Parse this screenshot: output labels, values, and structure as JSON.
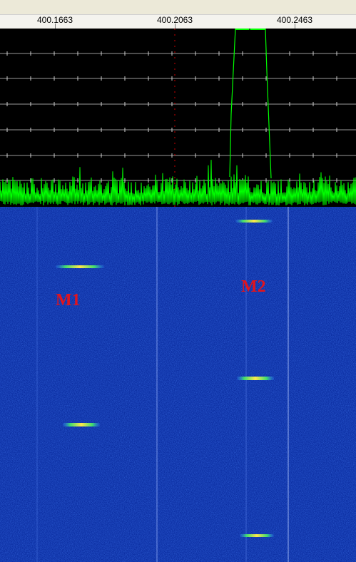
{
  "ruler": {
    "frequencies": [
      "400.1663",
      "400.2063",
      "400.2463"
    ]
  },
  "markers": {
    "m1_label": "M1",
    "m2_label": "M2"
  },
  "colors": {
    "spectrum_trace": "#00ff00",
    "grid_line": "#9a9a9a",
    "center_line": "#cc0000",
    "waterfall_bg": "#0a2ca0",
    "marker_text": "#e0141e"
  }
}
